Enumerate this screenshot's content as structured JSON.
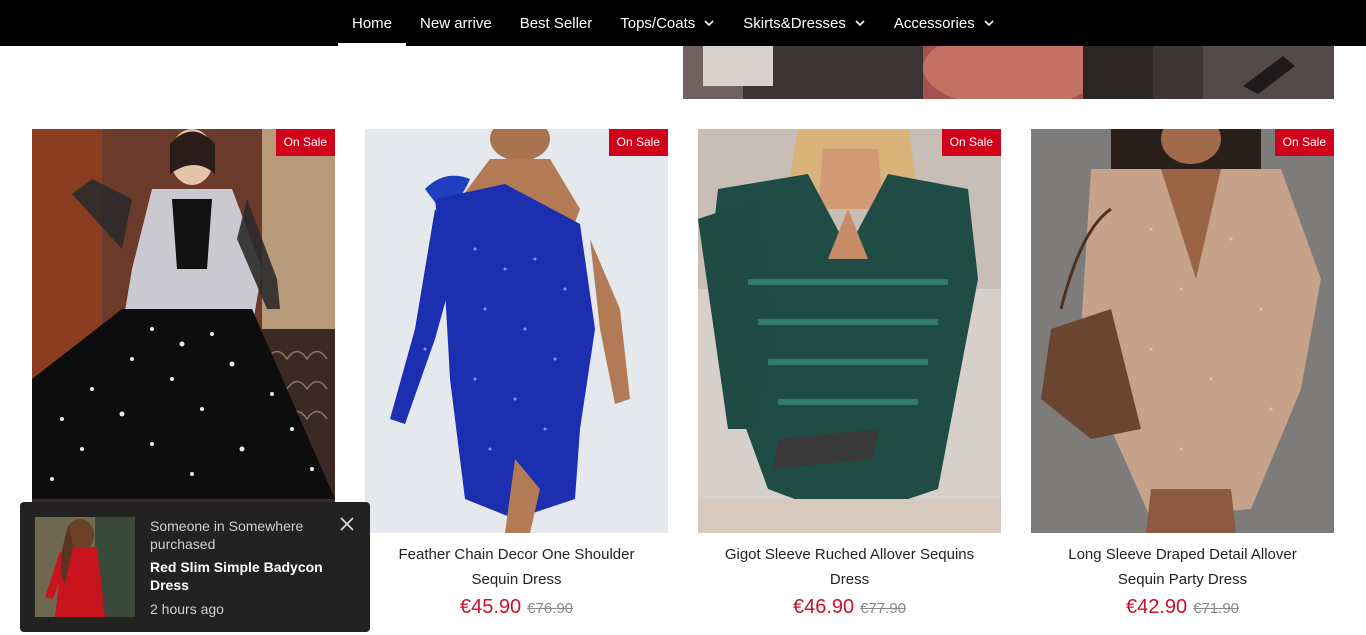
{
  "nav": {
    "items": [
      {
        "label": "Home",
        "active": true,
        "dropdown": false
      },
      {
        "label": "New arrive",
        "active": false,
        "dropdown": false
      },
      {
        "label": "Best Seller",
        "active": false,
        "dropdown": false
      },
      {
        "label": "Tops/Coats",
        "active": false,
        "dropdown": true
      },
      {
        "label": "Skirts&Dresses",
        "active": false,
        "dropdown": true
      },
      {
        "label": "Accessories",
        "active": false,
        "dropdown": true
      }
    ]
  },
  "products": [
    {
      "title": "",
      "price": "",
      "old_price": "",
      "badge": "On Sale"
    },
    {
      "title": "Feather Chain Decor One Shoulder Sequin Dress",
      "price": "€45.90",
      "old_price": "€76.90",
      "badge": "On Sale"
    },
    {
      "title": "Gigot Sleeve Ruched Allover Sequins Dress",
      "price": "€46.90",
      "old_price": "€77.90",
      "badge": "On Sale"
    },
    {
      "title": "Long Sleeve Draped Detail Allover Sequin Party Dress",
      "price": "€42.90",
      "old_price": "€71.90",
      "badge": "On Sale"
    }
  ],
  "popup": {
    "who": "Someone in Somewhere purchased",
    "product": "Red Slim Simple Badycon Dress",
    "time": "2 hours ago"
  },
  "colors": {
    "nav_bg": "#000000",
    "sale_badge": "#d0021b",
    "price": "#c8102e",
    "popup_bg": "#222222"
  },
  "icons": {
    "dropdown": "chevron-down-icon",
    "close": "close-icon"
  }
}
